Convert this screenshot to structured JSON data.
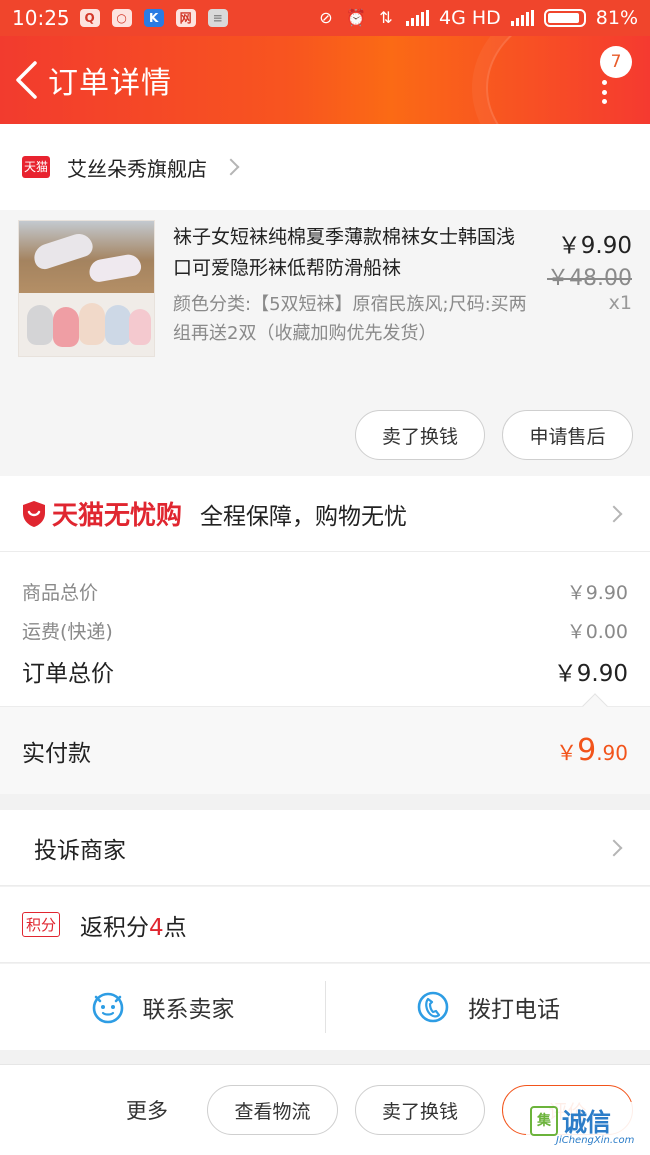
{
  "status_bar": {
    "time": "10:25",
    "network": "4G HD",
    "battery": "81%",
    "app_icons": [
      "qq-icon",
      "bubble-icon",
      "k-app-icon",
      "netease-icon",
      "notes-icon"
    ]
  },
  "header": {
    "title": "订单详情",
    "message_count": "7"
  },
  "shop": {
    "name": "艾丝朵秀旗舰店",
    "badge": "天猫"
  },
  "item": {
    "title": "袜子女短袜纯棉夏季薄款棉袜女士韩国浅口可爱隐形袜低帮防滑船袜",
    "spec": "颜色分类:【5双短袜】原宿民族风;尺码:买两组再送2双（收藏加购优先发货）",
    "price": "￥9.90",
    "original_price": "￥48.00",
    "quantity": "x1",
    "buttons": {
      "sell": "卖了换钱",
      "after_sales": "申请售后"
    }
  },
  "guarantee": {
    "brand": "天猫无忧购",
    "description": "全程保障，购物无忧"
  },
  "totals": {
    "goods_label": "商品总价",
    "goods_value": "￥9.90",
    "shipping_label": "运费(快递)",
    "shipping_value": "￥0.00",
    "order_label": "订单总价",
    "order_value": "￥9.90",
    "paid_label": "实付款",
    "paid_currency": "￥",
    "paid_int": "9",
    "paid_dec": ".90"
  },
  "complain": {
    "label": "投诉商家"
  },
  "points": {
    "tag": "积分",
    "prefix": "返积分",
    "count": "4",
    "suffix": "点"
  },
  "contact": {
    "seller": "联系卖家",
    "phone": "拨打电话"
  },
  "bottom_bar": {
    "more": "更多",
    "logistics": "查看物流",
    "sell": "卖了换钱",
    "evaluate": "评价"
  },
  "watermark": {
    "box": "集",
    "name": "诚信",
    "domain": "JiChengXin.com"
  },
  "colors": {
    "brand_red": "#e02630",
    "accent_orange": "#f2541b",
    "header_start": "#f23b2e",
    "header_end": "#fb6a15"
  }
}
